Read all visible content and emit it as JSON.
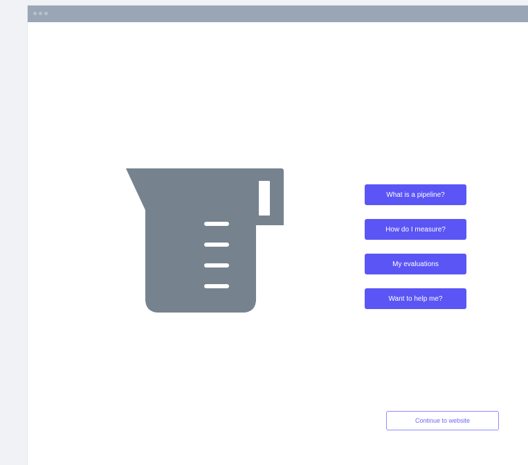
{
  "window": {
    "titlebar_dots": 3
  },
  "illustration": {
    "icon": "measuring-jug-icon",
    "color": "#76838f"
  },
  "menu": {
    "items": [
      {
        "label": "What is a pipeline?"
      },
      {
        "label": "How do I measure?"
      },
      {
        "label": "My evaluations"
      },
      {
        "label": "Want to help me?"
      }
    ]
  },
  "footer": {
    "continue_label": "Continue to website"
  },
  "colors": {
    "accent": "#5b55f5",
    "titlebar": "#9aa6b6",
    "background": "#ffffff"
  }
}
